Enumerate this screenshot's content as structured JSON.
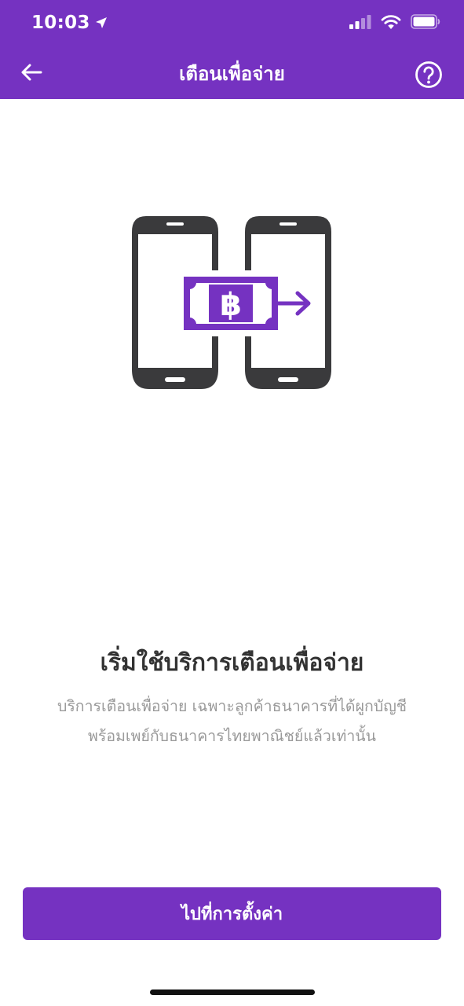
{
  "status_bar": {
    "time": "10:03"
  },
  "nav": {
    "title": "เตือนเพื่อจ่าย"
  },
  "content": {
    "headline": "เริ่มใช้บริการเตือนเพื่อจ่าย",
    "description_line_1": "บริการเตือนเพื่อจ่าย เฉพาะลูกค้าธนาคารที่ได้ผูกบัญชี",
    "description_line_2": "พร้อมเพย์กับธนาคารไทยพาณิชย์แล้วเท่านั้น",
    "illustration_currency_symbol": "฿"
  },
  "actions": {
    "settings_button_label": "ไปที่การตั้งค่า"
  },
  "colors": {
    "brand_purple": "#7532c1",
    "phone_dark": "#3a3a3c"
  }
}
